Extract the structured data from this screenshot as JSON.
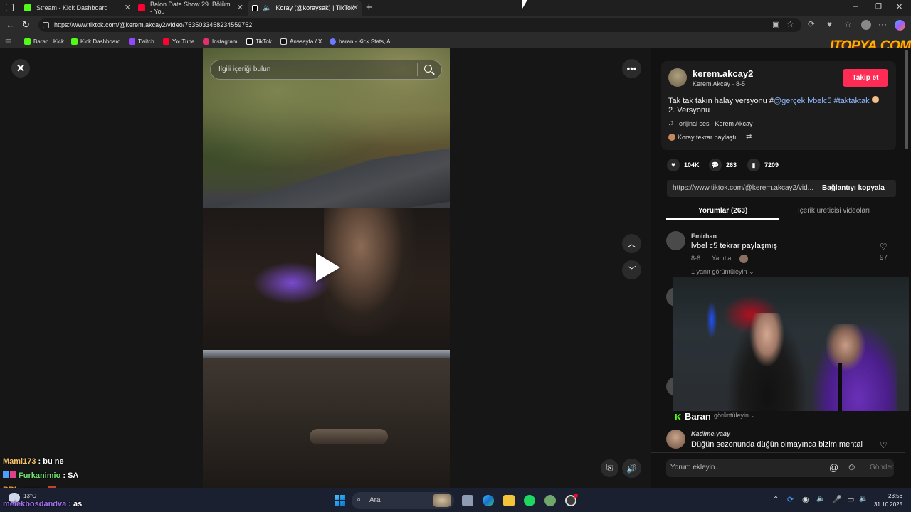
{
  "tabs": [
    {
      "label": "Stream - Kick Dashboard",
      "color": "#53fc18"
    },
    {
      "label": "Balon Date Show 29. Bölüm - You",
      "color": "#ff0033"
    },
    {
      "label": "Koray (@koraysak) | TikTok",
      "color": "#ffffff"
    }
  ],
  "address": {
    "url": "https://www.tiktok.com/@kerem.akcay2/video/7535033458234559752"
  },
  "bookmarks": [
    {
      "label": "Baran | Kick",
      "color": "#53fc18"
    },
    {
      "label": "Kick Dashboard",
      "color": "#53fc18"
    },
    {
      "label": "Twitch",
      "color": "#9146ff"
    },
    {
      "label": "YouTube",
      "color": "#ff0033"
    },
    {
      "label": "Instagram",
      "color": "#e1306c"
    },
    {
      "label": "TikTok",
      "color": "#ffffff"
    },
    {
      "label": "Anasayfa / X",
      "color": "#ffffff"
    },
    {
      "label": "baran - Kick Stats, A...",
      "color": "#8888ff"
    }
  ],
  "watermark": "ITOPYA.COM",
  "video": {
    "search_placeholder": "İlgili içeriği bulun"
  },
  "author": {
    "username": "kerem.akcay2",
    "display": "Kerem Akcay · 8-5",
    "follow": "Takip et"
  },
  "caption": {
    "text1": "Tak tak takın halay versyonu #",
    "mention": "@gerçek lvbelc5",
    "hashtag": "#taktaktak",
    "text2": "2. Versyonu",
    "sound": "orijinal ses - Kerem Akcay",
    "repost": "Koray tekrar paylaştı"
  },
  "stats": {
    "likes": "104K",
    "comments": "263",
    "saves": "7209"
  },
  "link": {
    "url": "https://www.tiktok.com/@kerem.akcay2/vid...",
    "copy": "Bağlantıyı kopyala"
  },
  "panel_tabs": {
    "comments": "Yorumlar (263)",
    "creator": "İçerik üreticisi videoları"
  },
  "comments": [
    {
      "user": "Emirhan",
      "text": "lvbel c5 tekrar paylaşmış",
      "date": "8-6",
      "reply": "Yanıtla",
      "likes": "97",
      "more": "1 yanıt görüntüleyin"
    },
    {
      "user": "Kadime.yaay",
      "text": "Düğün sezonunda düğün olmayınca bizim mental"
    }
  ],
  "hidden_reply_fragment": "görüntüleyin",
  "comment_input": {
    "placeholder": "Yorum ekleyin...",
    "send": "Gönder"
  },
  "overlay": {
    "streamer": "Baran"
  },
  "chat": [
    {
      "user": "Mami173",
      "msg": "bu ne",
      "color": "#f5c26b"
    },
    {
      "user": "Furkanimio",
      "msg": "SA",
      "color": "#6fe06f"
    },
    {
      "user": "BBLegzoz",
      "msg": "",
      "color": "#f0a030"
    },
    {
      "user": "melekbosdandva",
      "msg": "as",
      "color": "#a070f0"
    }
  ],
  "taskbar": {
    "search": "Ara",
    "weather": "13°C",
    "time": "23:56",
    "date": "31.10.2025"
  }
}
